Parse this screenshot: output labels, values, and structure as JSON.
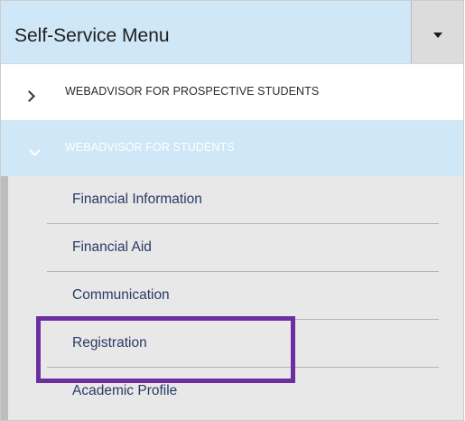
{
  "menu": {
    "title": "Self-Service Menu",
    "toggle_icon": "caret-down-icon"
  },
  "sections": [
    {
      "label": "WEBADVISOR FOR PROSPECTIVE STUDENTS",
      "expanded": false,
      "icon": "chevron-right-icon"
    },
    {
      "label": "WEBADVISOR FOR STUDENTS",
      "expanded": true,
      "icon": "chevron-down-icon",
      "items": [
        {
          "label": "Financial Information"
        },
        {
          "label": "Financial Aid"
        },
        {
          "label": "Communication"
        },
        {
          "label": "Registration",
          "highlighted": true
        },
        {
          "label": "Academic Profile"
        }
      ]
    }
  ],
  "colors": {
    "header_bg": "#cfe7f7",
    "active_section_bg": "#cfe7f7",
    "submenu_bg": "#e8e8e8",
    "link_text": "#2b3a66",
    "highlight_border": "#6b2fa0"
  }
}
